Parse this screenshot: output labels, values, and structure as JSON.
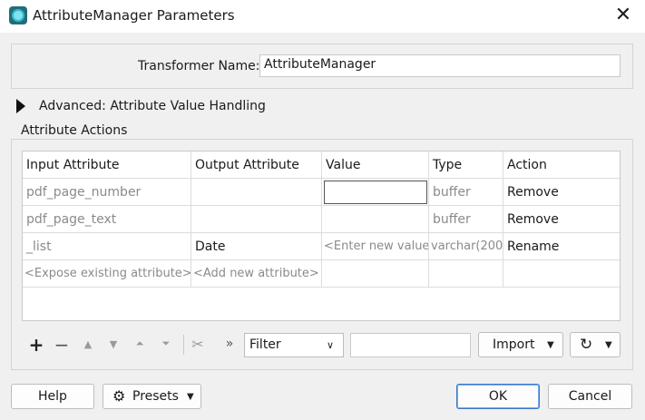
{
  "window": {
    "title": "AttributeManager Parameters"
  },
  "transformer": {
    "label": "Transformer Name:",
    "value": "AttributeManager"
  },
  "advanced": {
    "label": "Advanced: Attribute Value Handling"
  },
  "actions": {
    "group_label": "Attribute Actions",
    "columns": [
      "Input Attribute",
      "Output Attribute",
      "Value",
      "Type",
      "Action"
    ],
    "rows": [
      [
        "pdf_page_number",
        "",
        "",
        "buffer",
        "Remove"
      ],
      [
        "pdf_page_text",
        "",
        "",
        "buffer",
        "Remove"
      ],
      [
        "_list",
        "Date",
        "<Enter new value",
        "varchar(200)",
        "Rename"
      ],
      [
        "<Expose existing attribute>",
        "<Add new attribute>",
        "",
        "",
        ""
      ]
    ]
  },
  "toolbar": {
    "icons": [
      "add-icon",
      "remove-icon",
      "move-up-icon",
      "move-down-icon",
      "move-top-icon",
      "move-bottom-icon",
      "cut-icon",
      "more-icon"
    ],
    "filter_label": "Filter",
    "filter_text": "",
    "import_label": "Import"
  },
  "footer": {
    "help_label": "Help",
    "presets_label": "Presets",
    "ok_label": "OK",
    "cancel_label": "Cancel"
  }
}
